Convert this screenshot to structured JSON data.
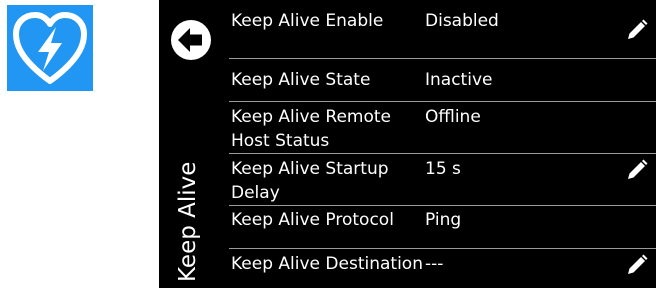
{
  "panel": {
    "title": "Keep Alive",
    "rows": [
      {
        "label": "Keep Alive Enable",
        "value": "Disabled",
        "editable": true
      },
      {
        "label": "Keep Alive State",
        "value": "Inactive",
        "editable": false
      },
      {
        "label": "Keep Alive Remote Host Status",
        "value": "Offline",
        "editable": false
      },
      {
        "label": "Keep Alive Startup Delay",
        "value": "15 s",
        "editable": true
      },
      {
        "label": "Keep Alive Protocol",
        "value": "Ping",
        "editable": false
      },
      {
        "label": "Keep Alive Destination",
        "value": "---",
        "editable": true
      }
    ]
  },
  "icons": {
    "app": "heart-lightning-icon",
    "back": "back-arrow-icon",
    "edit": "pencil-icon"
  },
  "colors": {
    "app_icon_bg": "#2196f3",
    "panel_bg": "#000000",
    "text": "#ffffff",
    "divider": "#9a9a9a"
  }
}
